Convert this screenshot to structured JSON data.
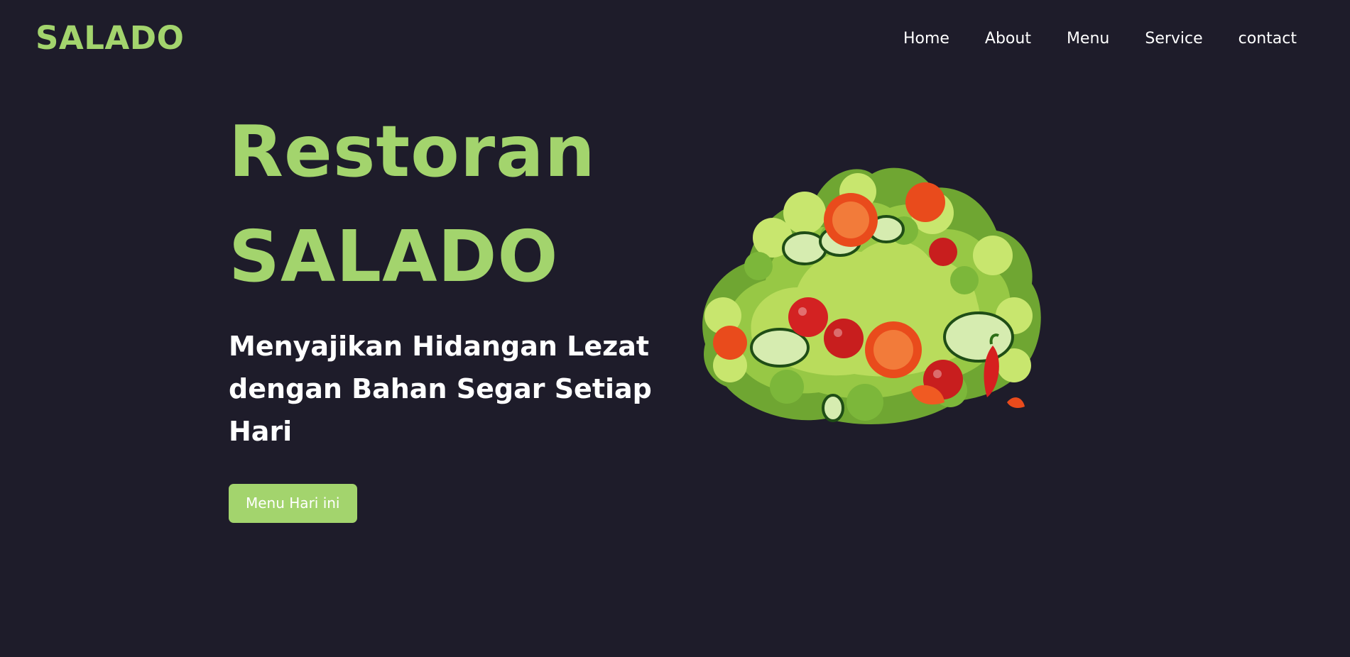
{
  "header": {
    "logo": "SALADO",
    "nav": [
      {
        "label": "Home"
      },
      {
        "label": "About"
      },
      {
        "label": "Menu"
      },
      {
        "label": "Service"
      },
      {
        "label": "contact"
      }
    ]
  },
  "hero": {
    "title_line1": "Restoran",
    "title_line2": "SALADO",
    "subtitle": "Menyajikan Hidangan Lezat dengan Bahan Segar Setiap Hari",
    "button_label": "Menu Hari ini",
    "image_icon": "salad-bowl-illustration"
  },
  "colors": {
    "background": "#1e1c2a",
    "accent": "#a3d46d",
    "text": "#ffffff"
  }
}
